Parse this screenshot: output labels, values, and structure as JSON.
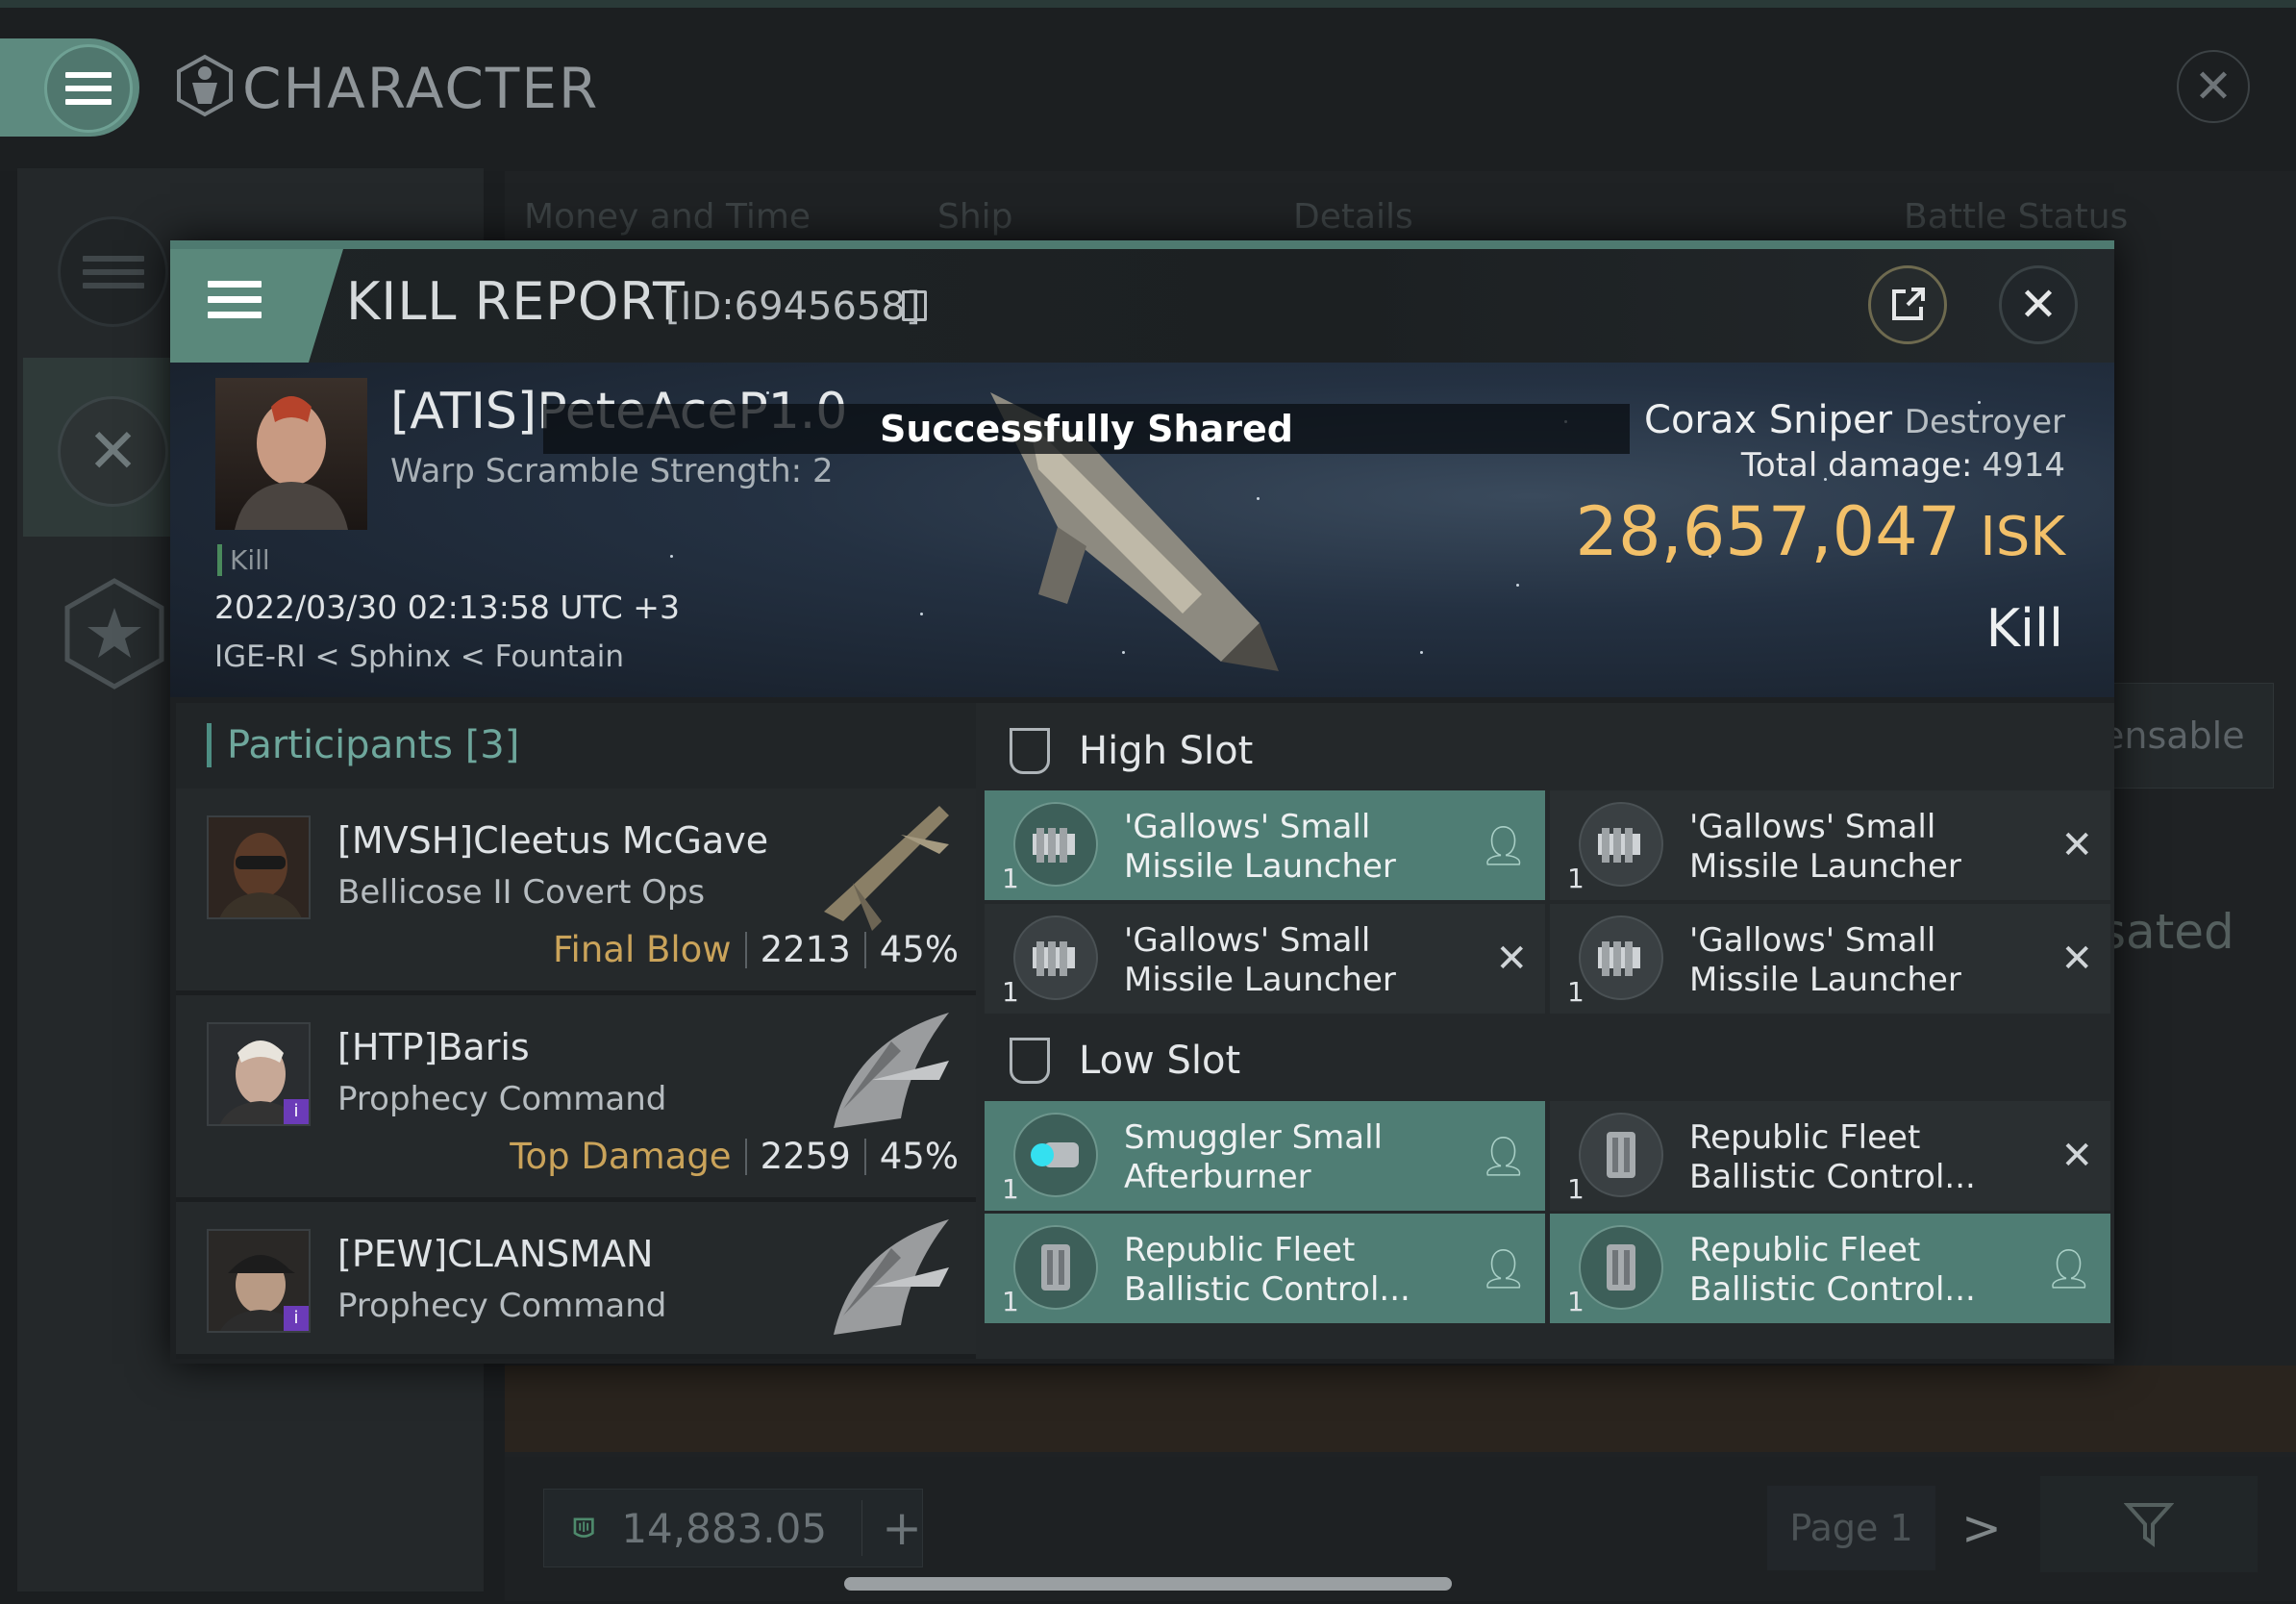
{
  "app": {
    "title": "CHARACTER"
  },
  "background": {
    "tabs": [
      "Money and Time",
      "Ship",
      "Details",
      "Battle Status"
    ],
    "side_text_1": "ensable",
    "side_text_2": "sated",
    "wallet_value": "14,883.05",
    "wallet_plus": "+",
    "page_label": "Page 1",
    "next": ">"
  },
  "kill_report": {
    "title": "KILL REPORT",
    "id": "[ID:6945658]",
    "banner": "Successfully Shared",
    "victim": {
      "name": "[ATIS]PeteAceP1.0",
      "warp": "Warp Scramble Strength: 2",
      "tag": "Kill",
      "date": "2022/03/30 02:13:58 UTC +3",
      "location": "IGE-RI < Sphinx < Fountain",
      "ship": "Corax Sniper",
      "ship_class": "Destroyer",
      "total_damage_label": "Total damage:",
      "total_damage": "4914",
      "isk": "28,657,047",
      "isk_unit": "ISK",
      "result": "Kill"
    },
    "participants": {
      "label": "Participants",
      "count": "[3]",
      "rows": [
        {
          "name": "[MVSH]Cleetus McGave",
          "ship": "Bellicose II Covert Ops",
          "label": "Final Blow",
          "damage": "2213",
          "pct": "45%"
        },
        {
          "name": "[HTP]Baris",
          "ship": "Prophecy Command",
          "label": "Top Damage",
          "damage": "2259",
          "pct": "45%"
        },
        {
          "name": "[PEW]CLANSMAN",
          "ship": "Prophecy Command"
        }
      ]
    },
    "high_slot": {
      "title": "High Slot",
      "items": [
        {
          "name": "'Gallows' Small\nMissile Launcher",
          "qty": "1",
          "status": "person-icon"
        },
        {
          "name": "'Gallows' Small\nMissile Launcher",
          "qty": "1",
          "status": "x-icon"
        },
        {
          "name": "'Gallows' Small\nMissile Launcher",
          "qty": "1",
          "status": "x-icon"
        },
        {
          "name": "'Gallows' Small\nMissile Launcher",
          "qty": "1",
          "status": "x-icon"
        }
      ]
    },
    "low_slot": {
      "title": "Low Slot",
      "items": [
        {
          "name": "Smuggler Small\nAfterburner",
          "qty": "1",
          "status": "person-icon"
        },
        {
          "name": "Republic Fleet\nBallistic Control...",
          "qty": "1",
          "status": "x-icon"
        },
        {
          "name": "Republic Fleet\nBallistic Control...",
          "qty": "1",
          "status": "person-icon"
        },
        {
          "name": "Republic Fleet\nBallistic Control...",
          "qty": "1",
          "status": "person-icon"
        }
      ]
    }
  },
  "colors": {
    "accent": "#4f7d74",
    "isk": "#f2c069",
    "label_gold": "#caa35a"
  }
}
